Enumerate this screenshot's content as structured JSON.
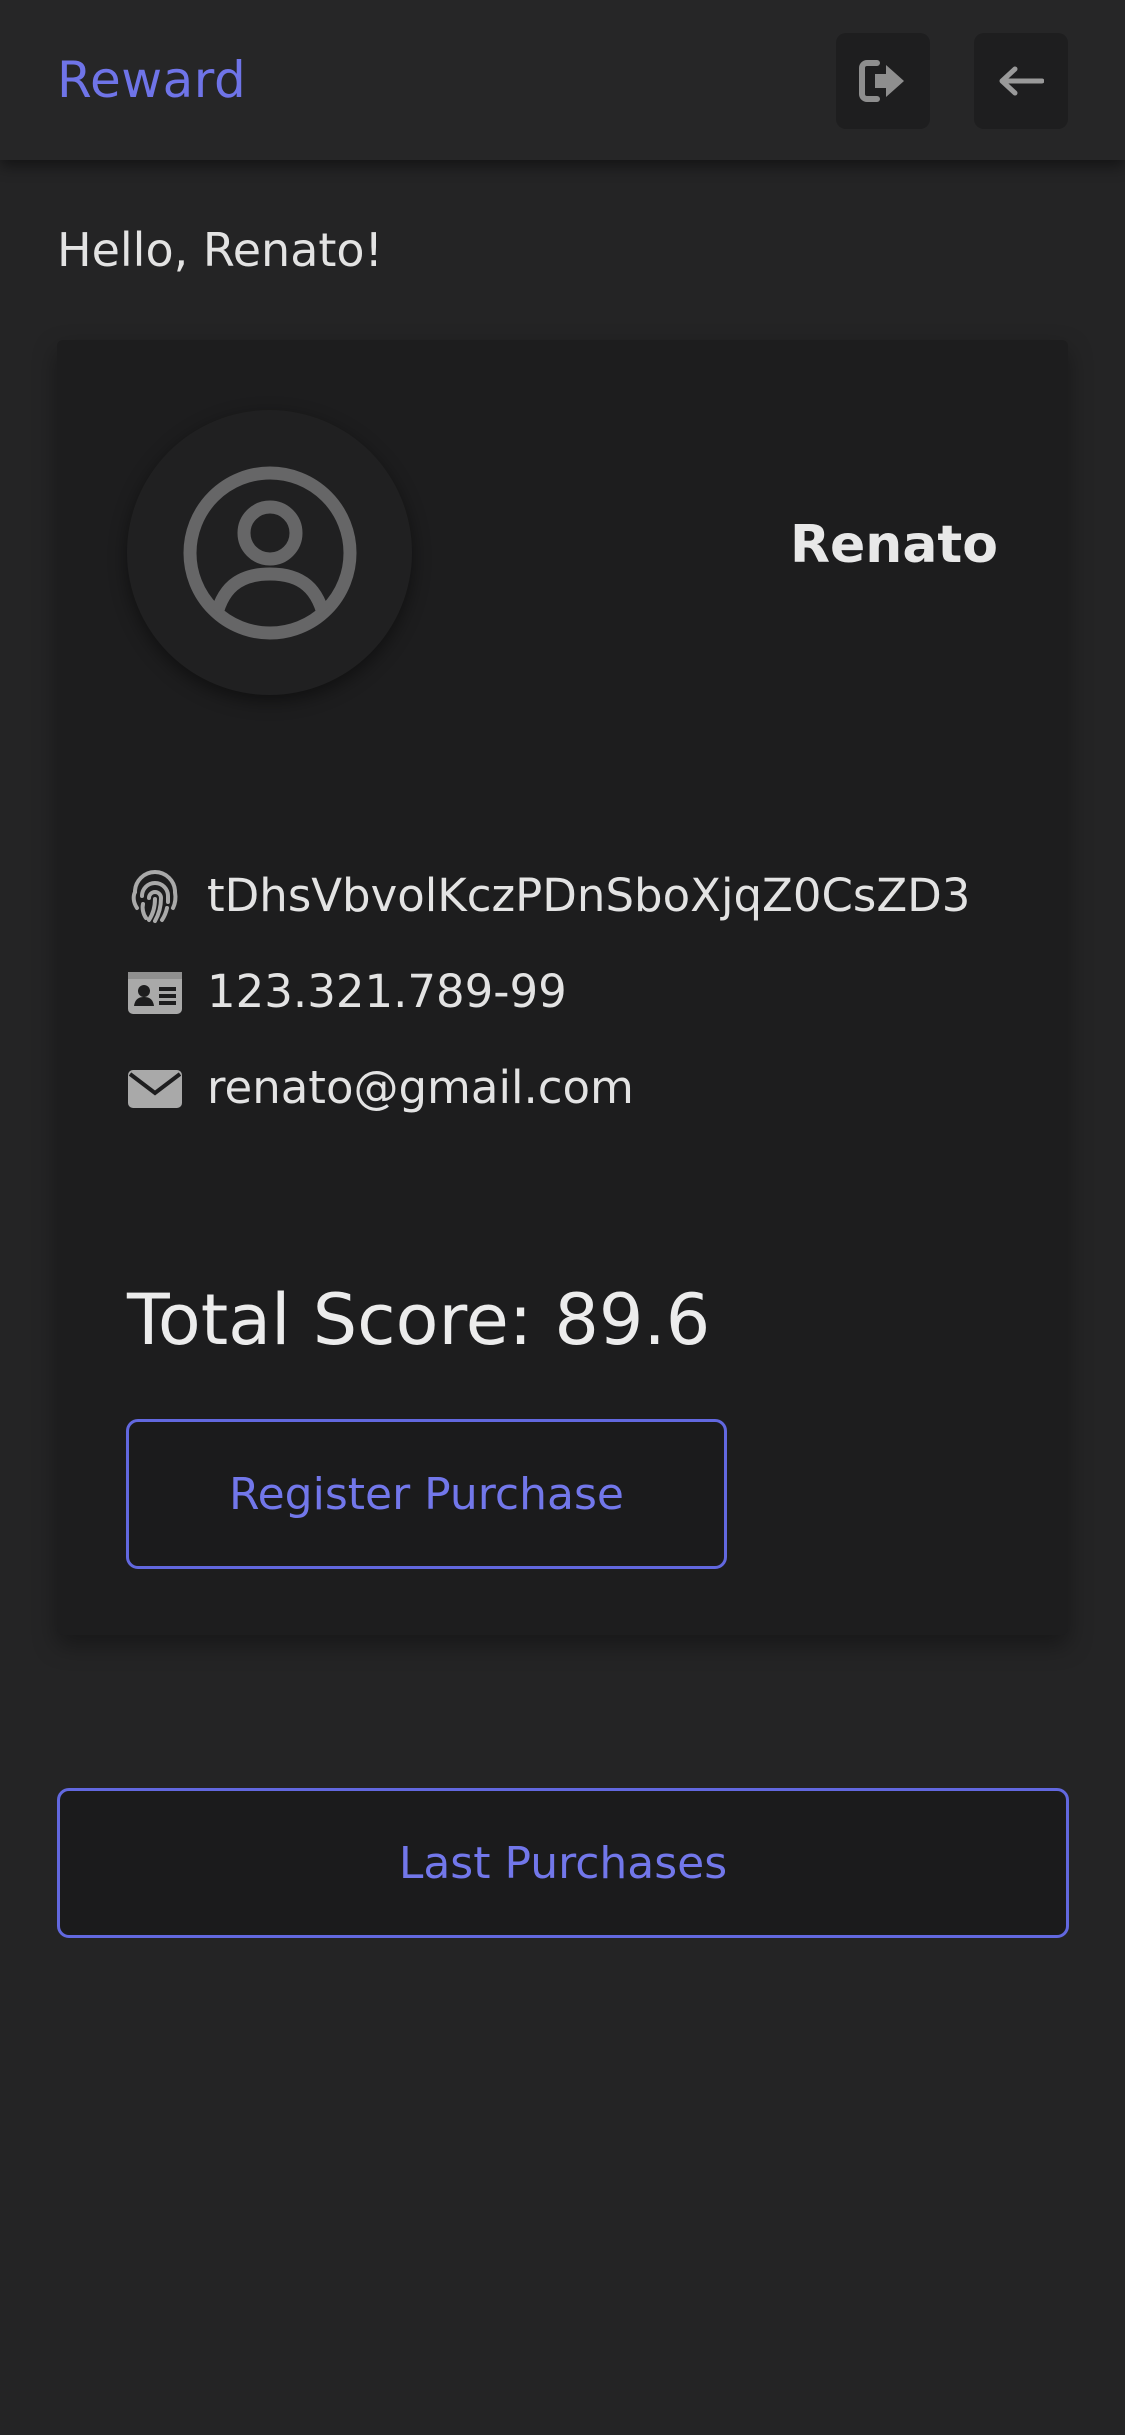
{
  "header": {
    "title": "Reward",
    "logout_icon": "logout-icon",
    "back_icon": "arrow-left-icon"
  },
  "greeting": "Hello, Renato!",
  "profile": {
    "avatar_icon": "user-circle-icon",
    "name": "Renato",
    "uid": "tDhsVbvolKczPDnSboXjqZ0CsZD3",
    "document": "123.321.789-99",
    "email": "renato@gmail.com",
    "icons": {
      "uid": "fingerprint-icon",
      "document": "id-card-icon",
      "email": "envelope-icon"
    }
  },
  "score": {
    "label": "Total Score:",
    "value": "89.6"
  },
  "buttons": {
    "register_purchase": "Register Purchase",
    "last_purchases": "Last Purchases"
  },
  "colors": {
    "accent": "#6f74e8",
    "background": "#242425",
    "card": "#1d1d1e",
    "icon_gray": "#a9a9a9"
  }
}
